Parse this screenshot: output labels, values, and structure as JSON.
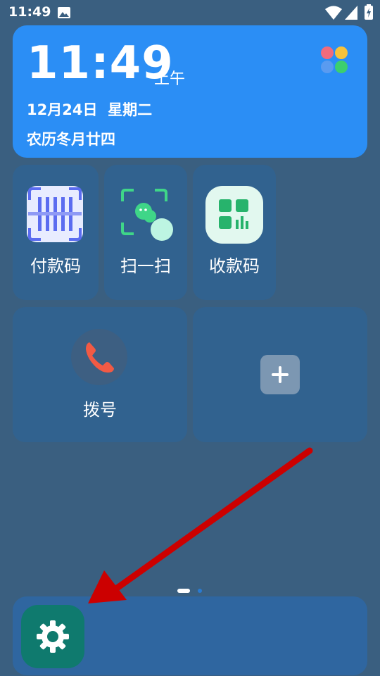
{
  "status_bar": {
    "time": "11:49",
    "icons": [
      "image-icon",
      "wifi-icon",
      "signal-icon",
      "battery-charging-icon"
    ]
  },
  "clock_widget": {
    "time": "11:49",
    "ampm": "上午",
    "date": "12月24日  星期二",
    "lunar": "农历冬月廿四",
    "apps_icon": "colorful-apps-icon"
  },
  "tiles": {
    "pay_code": {
      "label": "付款码",
      "icon": "barcode-icon"
    },
    "scan": {
      "label": "扫一扫",
      "icon": "wechat-scan-icon"
    },
    "receive_code": {
      "label": "收款码",
      "icon": "receive-code-icon"
    },
    "dial": {
      "label": "拨号",
      "icon": "phone-icon"
    },
    "add": {
      "icon": "plus-icon"
    }
  },
  "page_indicator": {
    "pages": 2,
    "current": 1
  },
  "dock": {
    "apps": [
      {
        "name": "settings",
        "icon": "gear-icon"
      }
    ]
  },
  "annotation": {
    "arrow_color": "#cc0000"
  }
}
